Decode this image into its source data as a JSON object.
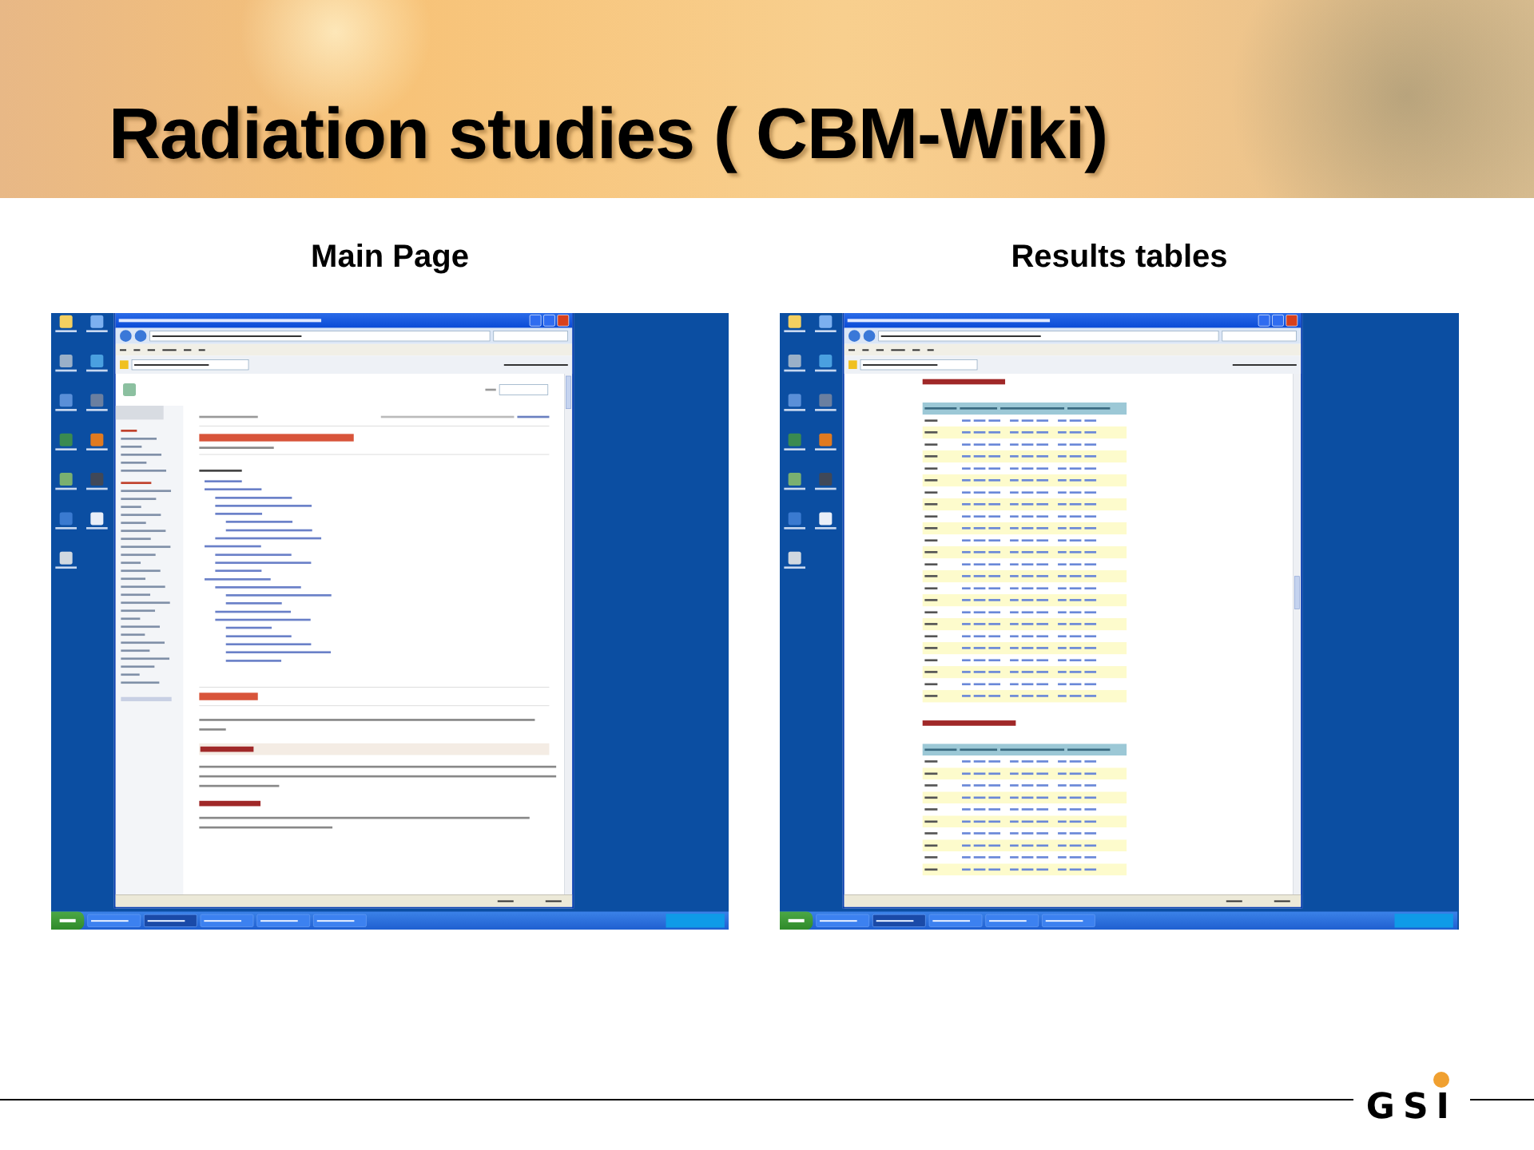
{
  "slide": {
    "title": "Radiation studies ( CBM-Wiki)"
  },
  "panels": [
    {
      "caption": "Main Page",
      "screenshot": {
        "kind": "wiki"
      }
    },
    {
      "caption": "Results tables",
      "screenshot": {
        "kind": "results"
      }
    }
  ],
  "footer": {
    "logo": "GSI"
  }
}
